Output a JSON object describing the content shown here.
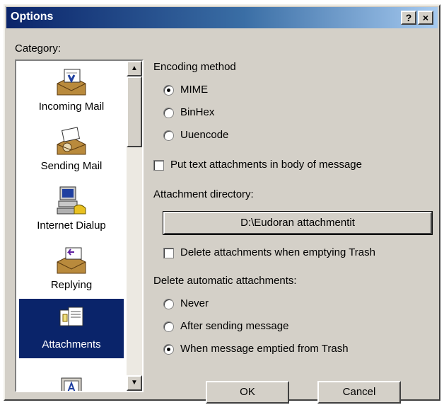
{
  "window": {
    "title": "Options",
    "help_label": "?",
    "close_label": "×"
  },
  "category": {
    "label": "Category:",
    "items": [
      {
        "label": "Incoming Mail",
        "icon": "incoming-mail-icon"
      },
      {
        "label": "Sending Mail",
        "icon": "sending-mail-icon"
      },
      {
        "label": "Internet Dialup",
        "icon": "internet-dialup-icon"
      },
      {
        "label": "Replying",
        "icon": "replying-icon"
      },
      {
        "label": "Attachments",
        "icon": "attachments-icon",
        "selected": true
      }
    ]
  },
  "encoding": {
    "label": "Encoding method",
    "options": [
      "MIME",
      "BinHex",
      "Uuencode"
    ],
    "selected": "MIME"
  },
  "put_text_label": "Put text attachments in body of message",
  "attachment_dir": {
    "label": "Attachment directory:",
    "value": "D:\\Eudoran attachmentit"
  },
  "delete_trash_label": "Delete attachments when emptying Trash",
  "delete_auto": {
    "label": "Delete automatic attachments:",
    "options": [
      "Never",
      "After sending message",
      "When message emptied from Trash"
    ],
    "selected": "When message emptied from Trash"
  },
  "buttons": {
    "ok": "OK",
    "cancel": "Cancel"
  },
  "colors": {
    "title_bar": "#0a246a",
    "selection": "#0a246a",
    "face": "#d4d0c8"
  }
}
